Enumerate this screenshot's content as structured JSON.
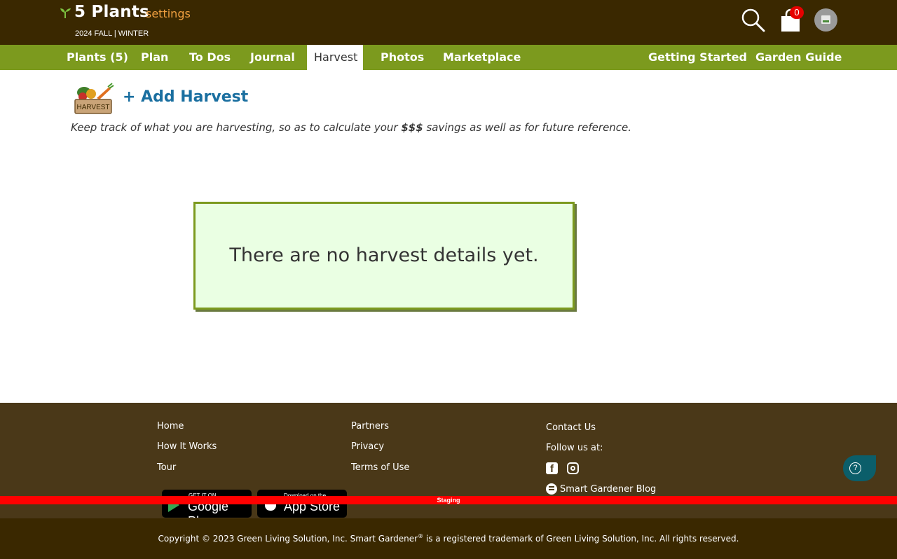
{
  "header": {
    "garden_title": "5 Plants",
    "settings_label": "settings",
    "season": "2024 FALL | WINTER",
    "cart_count": "0"
  },
  "nav": {
    "items": [
      {
        "label": "Plants (5)"
      },
      {
        "label": "Plan"
      },
      {
        "label": "To Dos"
      },
      {
        "label": "Journal"
      },
      {
        "label": "Harvest",
        "active": true
      },
      {
        "label": "Photos"
      },
      {
        "label": "Marketplace"
      },
      {
        "label": "Getting Started"
      },
      {
        "label": "Garden Guide"
      }
    ]
  },
  "main": {
    "logo_text": "HARVEST",
    "add_harvest_label": "+ Add Harvest",
    "intro_before": "Keep track of what you are harvesting, so as to calculate your ",
    "intro_bold": "$$$",
    "intro_after": " savings as well as for future reference.",
    "empty_message": "There are no harvest details yet."
  },
  "footer": {
    "col1": [
      "Home",
      "How It Works",
      "Tour"
    ],
    "col2": [
      "Partners",
      "Privacy",
      "Terms of Use"
    ],
    "contact_label": "Contact Us",
    "follow_label": "Follow us at:",
    "blog_label": "Smart Gardener Blog",
    "google_play_small": "GET IT ON",
    "google_play_big": "Google Play",
    "app_store_small": "Download on the",
    "app_store_big": "App Store",
    "help_glyph": "?",
    "staging_label": "Staging",
    "copyright_before": "Copyright © 2023 Green Living Solution, Inc. Smart Gardener",
    "copyright_mark": "®",
    "copyright_after": " is a registered trademark of Green Living Solution, Inc. All rights reserved."
  },
  "colors": {
    "header_bg": "#3a2800",
    "nav_bg": "#7c9a1e",
    "settings_accent": "#f0a040",
    "link_blue": "#1a6fa0",
    "empty_box_bg": "#eaffe3",
    "footer_bg": "#4a3818",
    "staging_red": "#ff0000",
    "help_teal": "#0b5e6a"
  },
  "icons": [
    "sprout-icon",
    "search-icon",
    "cart-icon",
    "avatar",
    "harvest-basket-icon",
    "facebook-icon",
    "instagram-icon",
    "blogger-icon",
    "help-icon",
    "google-play-icon",
    "apple-icon"
  ]
}
